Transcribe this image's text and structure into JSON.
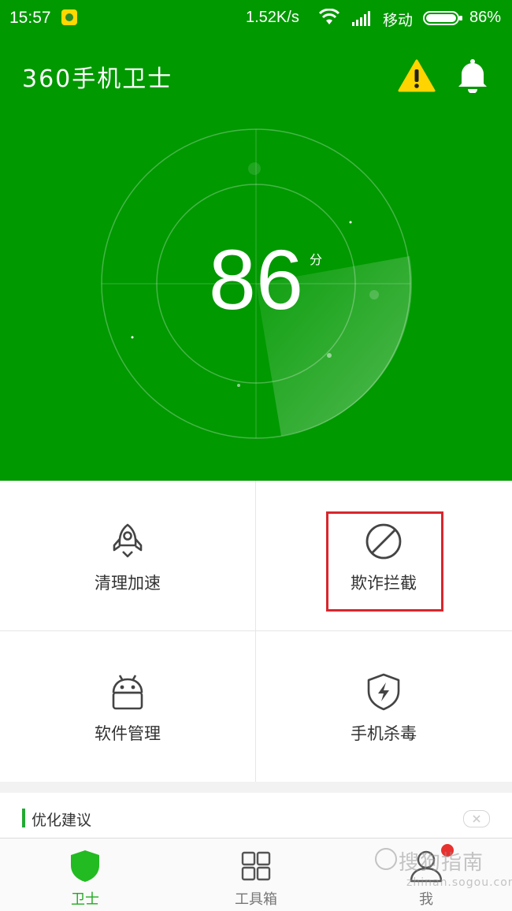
{
  "status_bar": {
    "time": "15:57",
    "net_speed": "1.52K/s",
    "carrier": "移动",
    "battery_pct": "86%",
    "icons": [
      "app-notification-icon",
      "wifi-icon",
      "signal-icon",
      "battery-icon"
    ]
  },
  "header": {
    "app_title": "360手机卫士",
    "score": "86",
    "score_unit": "分",
    "icons": [
      "warning-icon",
      "bell-icon"
    ]
  },
  "grid": {
    "items": [
      {
        "label": "清理加速",
        "icon": "rocket-icon"
      },
      {
        "label": "欺诈拦截",
        "icon": "block-icon"
      },
      {
        "label": "软件管理",
        "icon": "android-icon"
      },
      {
        "label": "手机杀毒",
        "icon": "shield-bolt-icon"
      }
    ]
  },
  "suggestion": {
    "title": "优化建议"
  },
  "bottom_nav": {
    "items": [
      {
        "label": "卫士",
        "icon": "shield-icon"
      },
      {
        "label": "工具箱",
        "icon": "grid-icon"
      },
      {
        "label": "我",
        "icon": "user-icon"
      }
    ]
  },
  "watermark": {
    "line1": "搜狗指南",
    "line2": "zhinan.sogou.com"
  },
  "colors": {
    "brand_green": "#009900",
    "active_green": "#22aa22",
    "highlight_red": "#d9262c",
    "badge_red": "#e8302e"
  }
}
